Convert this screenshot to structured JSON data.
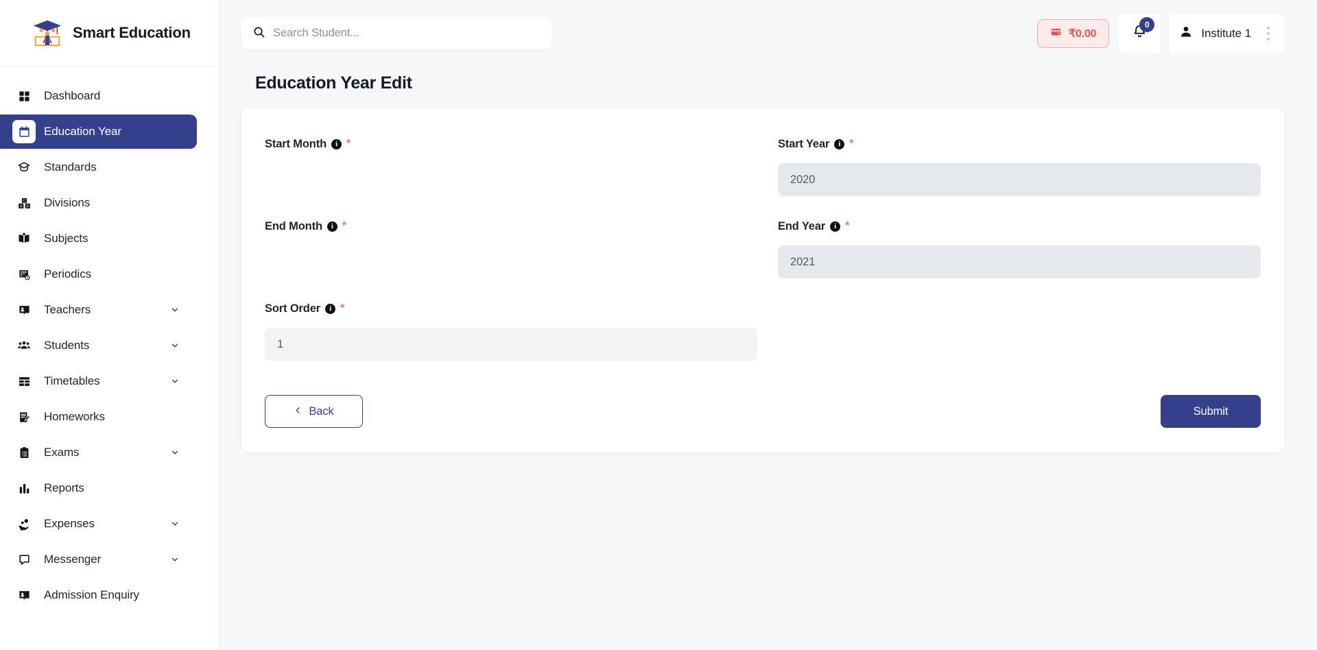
{
  "brand": {
    "name": "Smart Education",
    "logo_icon": "graduation-cap-book-logo"
  },
  "colors": {
    "accent_navy": "#34408c",
    "wallet_red": "#e2554f",
    "required_star": "#f07470",
    "page_bg": "#f6f7f9"
  },
  "sidebar": {
    "items": [
      {
        "label": "Dashboard",
        "icon": "grid-icon",
        "active": false,
        "expandable": false
      },
      {
        "label": "Education Year",
        "icon": "calendar-icon",
        "active": true,
        "expandable": false
      },
      {
        "label": "Standards",
        "icon": "graduation-cap-icon",
        "active": false,
        "expandable": false
      },
      {
        "label": "Divisions",
        "icon": "blocks-icon",
        "active": false,
        "expandable": false
      },
      {
        "label": "Subjects",
        "icon": "open-book-icon",
        "active": false,
        "expandable": false
      },
      {
        "label": "Periodics",
        "icon": "calendar-clock-icon",
        "active": false,
        "expandable": false
      },
      {
        "label": "Teachers",
        "icon": "teacher-board-icon",
        "active": false,
        "expandable": true
      },
      {
        "label": "Students",
        "icon": "users-group-icon",
        "active": false,
        "expandable": true
      },
      {
        "label": "Timetables",
        "icon": "table-icon",
        "active": false,
        "expandable": true
      },
      {
        "label": "Homeworks",
        "icon": "notebook-pen-icon",
        "active": false,
        "expandable": false
      },
      {
        "label": "Exams",
        "icon": "clipboard-list-icon",
        "active": false,
        "expandable": true
      },
      {
        "label": "Reports",
        "icon": "bar-chart-icon",
        "active": false,
        "expandable": false
      },
      {
        "label": "Expenses",
        "icon": "hand-coins-icon",
        "active": false,
        "expandable": true
      },
      {
        "label": "Messenger",
        "icon": "chat-bubble-icon",
        "active": false,
        "expandable": true
      },
      {
        "label": "Admission Enquiry",
        "icon": "person-board-icon",
        "active": false,
        "expandable": false
      }
    ]
  },
  "topbar": {
    "search": {
      "value": "",
      "placeholder": "Search Student...",
      "icon": "search-icon"
    },
    "wallet": {
      "amount": "₹0.00",
      "icon": "wallet-icon"
    },
    "notifications": {
      "count": "0",
      "icon": "bell-icon"
    },
    "user": {
      "name": "Institute 1",
      "icon": "user-avatar-icon"
    },
    "kebab_icon": "more-vertical-icon"
  },
  "page": {
    "title": "Education Year Edit"
  },
  "form": {
    "fields": {
      "start_month": {
        "label": "Start Month",
        "value": "",
        "has_input": false
      },
      "start_year": {
        "label": "Start Year",
        "value": "2020",
        "has_input": true
      },
      "end_month": {
        "label": "End Month",
        "value": "",
        "has_input": false
      },
      "end_year": {
        "label": "End Year",
        "value": "2021",
        "has_input": true
      },
      "sort_order": {
        "label": "Sort Order",
        "value": "1",
        "has_input": true
      }
    },
    "required_marker": "*",
    "info_glyph": "i",
    "buttons": {
      "back": "Back",
      "submit": "Submit"
    }
  }
}
